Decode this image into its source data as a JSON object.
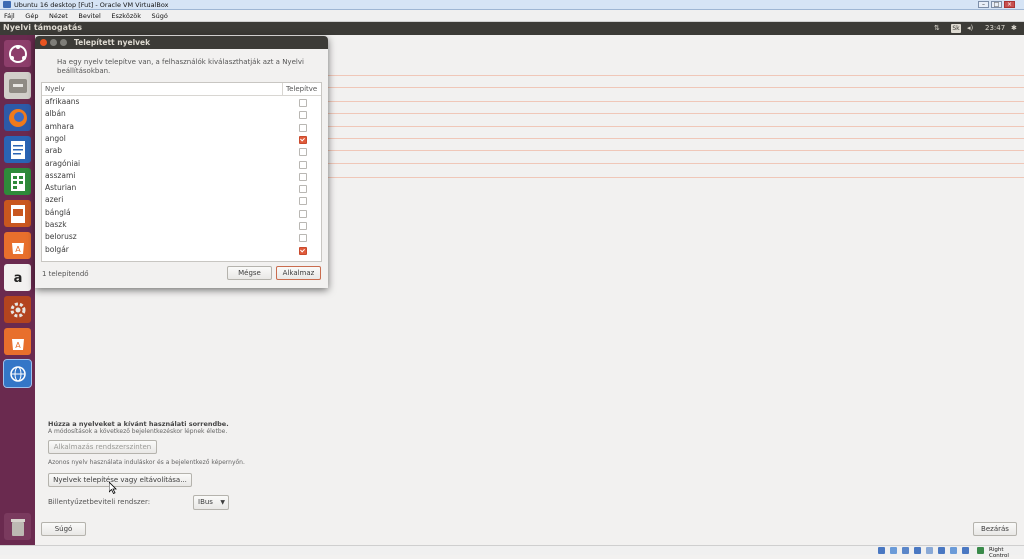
{
  "vbox": {
    "title": "Ubuntu 16 desktop [Fut] - Oracle VM VirtualBox",
    "menu": [
      "Fájl",
      "Gép",
      "Nézet",
      "Bevitel",
      "Eszközök",
      "Súgó"
    ],
    "status_host_key": "Right Control"
  },
  "topbar": {
    "app_title": "Nyelvi támogatás",
    "keyboard_indicator": "Sk",
    "clock": "23:47"
  },
  "launcher": {
    "items": [
      "dash-home",
      "files",
      "firefox",
      "writer",
      "calc",
      "impress",
      "software-center",
      "amazon",
      "system-settings",
      "software-updater",
      "language-support",
      "trash"
    ]
  },
  "main": {
    "hint_bold": "Húzza a nyelveket a kívánt használati sorrendbe.",
    "hint_small": "A módosítások a következő bejelentkezéskor lépnek életbe.",
    "apply_system_label": "Alkalmazás rendszerszinten",
    "login_screen_hint": "Azonos nyelv használata induláskor és a bejelentkező képernyőn.",
    "install_remove_label": "Nyelvek telepítése vagy eltávolítása...",
    "keyboard_input_label": "Billentyűzetbeviteli rendszer:",
    "keyboard_input_value": "IBus",
    "help_label": "Súgó",
    "close_label": "Bezárás"
  },
  "dialog": {
    "title": "Telepített nyelvek",
    "description": "Ha egy nyelv telepítve van, a felhasználók kiválaszthatják azt a Nyelvi beállításokban.",
    "col_language": "Nyelv",
    "col_installed": "Telepítve",
    "languages": [
      {
        "name": "afrikaans",
        "installed": false
      },
      {
        "name": "albán",
        "installed": false
      },
      {
        "name": "amhara",
        "installed": false
      },
      {
        "name": "angol",
        "installed": true
      },
      {
        "name": "arab",
        "installed": false
      },
      {
        "name": "aragóniai",
        "installed": false
      },
      {
        "name": "asszami",
        "installed": false
      },
      {
        "name": "Asturian",
        "installed": false
      },
      {
        "name": "azeri",
        "installed": false
      },
      {
        "name": "bánglá",
        "installed": false
      },
      {
        "name": "baszk",
        "installed": false
      },
      {
        "name": "belorusz",
        "installed": false
      },
      {
        "name": "bolgár",
        "installed": true
      }
    ],
    "pending_text": "1 telepítendő",
    "cancel_label": "Mégse",
    "apply_label": "Alkalmaz"
  },
  "colors": {
    "launcher_bg": "#6a2a4f",
    "topbar_bg": "#3c3b37",
    "accent": "#e05b3b"
  }
}
